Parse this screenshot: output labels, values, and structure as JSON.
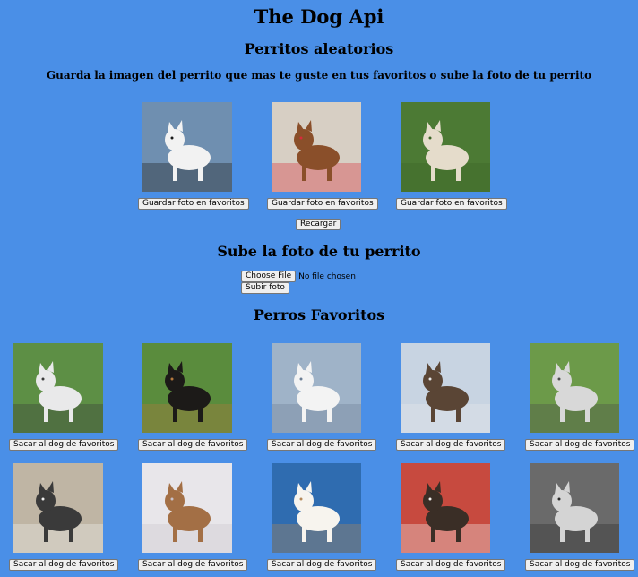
{
  "page": {
    "title": "The Dog Api",
    "random_heading": "Perritos aleatorios",
    "description": "Guarda la imagen del perrito que mas te guste en tus favoritos o sube la foto de tu perrito",
    "reload_label": "Recargar",
    "upload_heading": "Sube la foto de tu perrito",
    "choose_file_label": "Choose File",
    "no_file_text": "No file chosen",
    "upload_button_label": "Subir foto",
    "favorites_heading": "Perros Favoritos"
  },
  "random_dogs": [
    {
      "save_label": "Guardar foto en favoritos",
      "icon": "dog-photo-setter-mountains",
      "colors": {
        "bg": "#6f8fb0",
        "dog": "#f2f2f2",
        "accent": "#1a1a1a"
      }
    },
    {
      "save_label": "Guardar foto en favoritos",
      "icon": "dog-photo-border-collie-agility",
      "colors": {
        "bg": "#d7cfc4",
        "dog": "#8a4f2a",
        "accent": "#d62b3a"
      }
    },
    {
      "save_label": "Guardar foto en favoritos",
      "icon": "dog-photo-cream-dog-grass",
      "colors": {
        "bg": "#4c7a34",
        "dog": "#e5dccb",
        "accent": "#3b6427"
      }
    }
  ],
  "favorites": [
    {
      "remove_label": "Sacar al dog de favoritos",
      "icon": "dog-photo-husky-lying-grass",
      "colors": {
        "bg": "#5d8f45",
        "dog": "#e9e9ea",
        "accent": "#3a3a3a"
      }
    },
    {
      "remove_label": "Sacar al dog de favoritos",
      "icon": "dog-photo-black-fluffy-dog",
      "colors": {
        "bg": "#5a8c3d",
        "dog": "#1c1a18",
        "accent": "#b5793e"
      }
    },
    {
      "remove_label": "Sacar al dog de favoritos",
      "icon": "dog-photo-white-dog-snow",
      "colors": {
        "bg": "#9fb3c8",
        "dog": "#f3f3f3",
        "accent": "#6c7f96"
      }
    },
    {
      "remove_label": "Sacar al dog de favoritos",
      "icon": "dog-photo-malamute-snow",
      "colors": {
        "bg": "#c8d4e2",
        "dog": "#5a4535",
        "accent": "#e8e8ea"
      }
    },
    {
      "remove_label": "Sacar al dog de favoritos",
      "icon": "dog-photo-husky-standing",
      "colors": {
        "bg": "#6c9a49",
        "dog": "#d8d8d8",
        "accent": "#4b4b4b"
      }
    },
    {
      "remove_label": "Sacar al dog de favoritos",
      "icon": "dog-photo-husky-lying-floor",
      "colors": {
        "bg": "#bfb5a4",
        "dog": "#3a3a3a",
        "accent": "#f1f1f1"
      }
    },
    {
      "remove_label": "Sacar al dog de favoritos",
      "icon": "dog-photo-dog-running-snow",
      "colors": {
        "bg": "#e8e6ea",
        "dog": "#a36f45",
        "accent": "#c9c3cc"
      }
    },
    {
      "remove_label": "Sacar al dog de favoritos",
      "icon": "dog-photo-samoyed-sky",
      "colors": {
        "bg": "#2f6cb0",
        "dog": "#f7f4ee",
        "accent": "#b58a5a"
      }
    },
    {
      "remove_label": "Sacar al dog de favoritos",
      "icon": "dog-photo-border-collie-sign",
      "colors": {
        "bg": "#c74a3f",
        "dog": "#3a2e26",
        "accent": "#f3f1ee"
      }
    },
    {
      "remove_label": "Sacar al dog de favoritos",
      "icon": "dog-photo-pitbull-bw",
      "colors": {
        "bg": "#6a6a6a",
        "dog": "#d4d4d4",
        "accent": "#2a2a2a"
      }
    }
  ]
}
